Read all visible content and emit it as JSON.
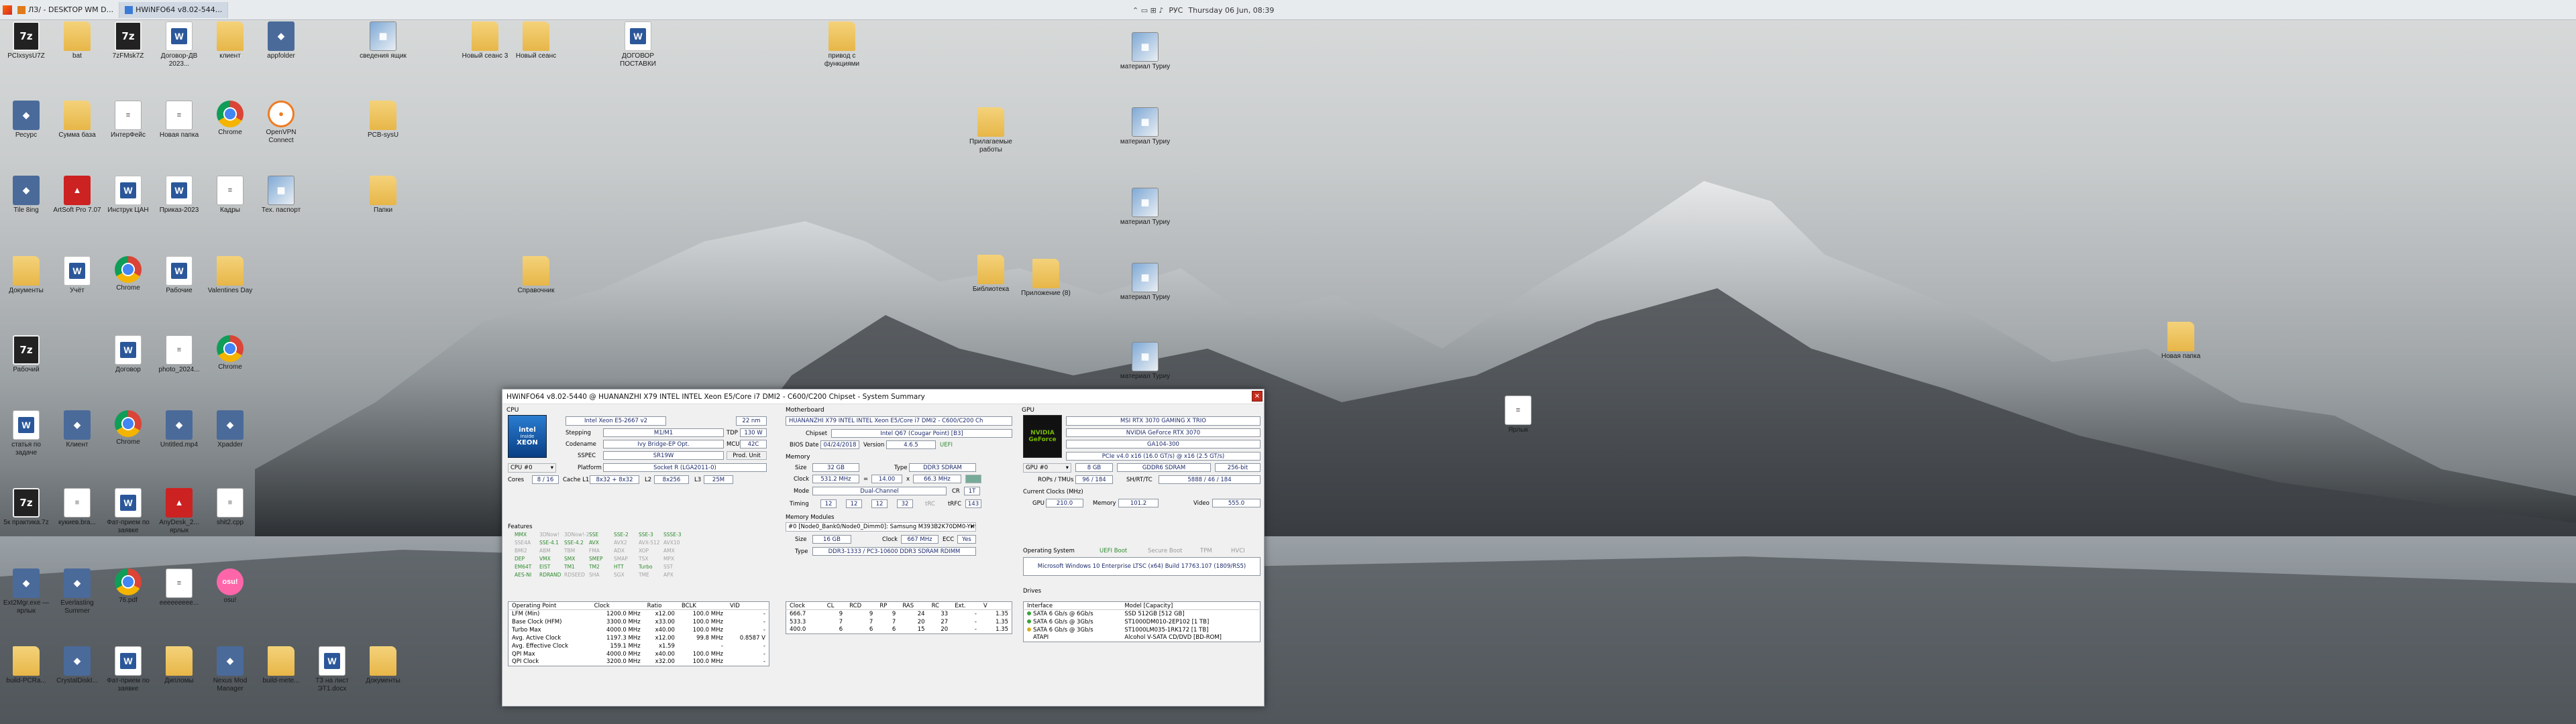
{
  "taskbar": {
    "items": [
      {
        "label": "ЛЗ/ - DESKTOP WM D...",
        "active": false
      },
      {
        "label": "HWiNFO64 v8.02-544...",
        "active": true
      }
    ],
    "tray": {
      "glyphs": "⌃ ▭ ⊞ ♪",
      "lang": "РУС",
      "datetime": "Thursday 06 Jun, 08:39"
    }
  },
  "icons": [
    {
      "id": "a1",
      "label": "PCIxsysU7Z",
      "kind": "7z"
    },
    {
      "id": "a2",
      "label": "bat",
      "kind": "folder"
    },
    {
      "id": "a3",
      "label": "7zFMsk7Z",
      "kind": "7z"
    },
    {
      "id": "a4",
      "label": "Договор-ДВ 2023...",
      "kind": "word"
    },
    {
      "id": "a5",
      "label": "клиент",
      "kind": "folder"
    },
    {
      "id": "a6",
      "label": "appfolder",
      "kind": "app"
    },
    {
      "id": "a7",
      "label": "сведения ящик",
      "kind": "img"
    },
    {
      "id": "a8",
      "label": "Новый сеанс 3",
      "kind": "folder"
    },
    {
      "id": "a9",
      "label": "Новый сеанс",
      "kind": "folder"
    },
    {
      "id": "a10",
      "label": "ДОГОВОР ПОСТАВКИ",
      "kind": "word"
    },
    {
      "id": "a11",
      "label": "привод с функциями",
      "kind": "folder"
    },
    {
      "id": "b1",
      "label": "Ресурс",
      "kind": "app"
    },
    {
      "id": "b2",
      "label": "Сумма база",
      "kind": "folder"
    },
    {
      "id": "b3",
      "label": "ИнтерФейс",
      "kind": "file"
    },
    {
      "id": "b4",
      "label": "Новая папка",
      "kind": "file"
    },
    {
      "id": "b5",
      "label": "Chrome",
      "kind": "chrome"
    },
    {
      "id": "b6",
      "label": "OpenVPN Connect",
      "kind": "ovpn"
    },
    {
      "id": "b7",
      "label": "PCB-sysU",
      "kind": "folder"
    },
    {
      "id": "c1",
      "label": "Tile 8ing",
      "kind": "app"
    },
    {
      "id": "c2",
      "label": "ArtSoft Pro 7.07",
      "kind": "red"
    },
    {
      "id": "c3",
      "label": "Инструк ЦАН",
      "kind": "word"
    },
    {
      "id": "c4",
      "label": "Приказ-2023",
      "kind": "word"
    },
    {
      "id": "c5",
      "label": "Кадры",
      "kind": "file"
    },
    {
      "id": "c6",
      "label": "Тех. паспорт",
      "kind": "img"
    },
    {
      "id": "c7",
      "label": "Папки",
      "kind": "folder"
    },
    {
      "id": "d1",
      "label": "Документы",
      "kind": "folder"
    },
    {
      "id": "d2",
      "label": "Учёт",
      "kind": "word"
    },
    {
      "id": "d3",
      "label": "Chrome",
      "kind": "chrome"
    },
    {
      "id": "d4",
      "label": "Рабочие",
      "kind": "word"
    },
    {
      "id": "d5",
      "label": "Valentines Day",
      "kind": "folder"
    },
    {
      "id": "d6",
      "label": "Справочник",
      "kind": "folder"
    },
    {
      "id": "e1",
      "label": "Рабочий",
      "kind": "7z"
    },
    {
      "id": "e2",
      "label": "Договор",
      "kind": "word"
    },
    {
      "id": "e3",
      "label": "photo_2024...",
      "kind": "file"
    },
    {
      "id": "e4",
      "label": "Chrome",
      "kind": "chrome"
    },
    {
      "id": "f1",
      "label": "статья по задаче",
      "kind": "word"
    },
    {
      "id": "f2",
      "label": "Клиент",
      "kind": "app"
    },
    {
      "id": "f3",
      "label": "Chrome",
      "kind": "chrome"
    },
    {
      "id": "f4",
      "label": "Untitled.mp4",
      "kind": "app"
    },
    {
      "id": "f5",
      "label": "Xpadder",
      "kind": "app"
    },
    {
      "id": "g1",
      "label": "5к практика.7z",
      "kind": "7z"
    },
    {
      "id": "g2",
      "label": "кукиев.bra...",
      "kind": "file"
    },
    {
      "id": "g3",
      "label": "Фат-прием по заявке",
      "kind": "word"
    },
    {
      "id": "g4",
      "label": "AnyDesk_2... ярлык",
      "kind": "red"
    },
    {
      "id": "g5",
      "label": "shit2.cpp",
      "kind": "file"
    },
    {
      "id": "h1",
      "label": "Ext2Mgr.exe — ярлык",
      "kind": "app"
    },
    {
      "id": "h2",
      "label": "Everlasting Summer",
      "kind": "app"
    },
    {
      "id": "h3",
      "label": "76.pdf",
      "kind": "chrome"
    },
    {
      "id": "h4",
      "label": "еееееееее...",
      "kind": "file"
    },
    {
      "id": "h5",
      "label": "osu!",
      "kind": "osu"
    },
    {
      "id": "i1",
      "label": "build-PCRa...",
      "kind": "folder"
    },
    {
      "id": "i2",
      "label": "CrystalDiskI...",
      "kind": "app"
    },
    {
      "id": "i3",
      "label": "Фат-прием по заявке",
      "kind": "word"
    },
    {
      "id": "i4",
      "label": "Дипломы",
      "kind": "folder"
    },
    {
      "id": "i5",
      "label": "Nexus Mod Manager",
      "kind": "app"
    },
    {
      "id": "i6",
      "label": "build-mete...",
      "kind": "folder"
    },
    {
      "id": "i7",
      "label": "ТЗ на лист ЭТ1.docx",
      "kind": "word"
    },
    {
      "id": "i8",
      "label": "Документы",
      "kind": "folder"
    },
    {
      "id": "r1",
      "label": "материал Туриу",
      "kind": "img"
    },
    {
      "id": "r2",
      "label": "материал Туриу",
      "kind": "img"
    },
    {
      "id": "r3",
      "label": "материал Туриу",
      "kind": "img"
    },
    {
      "id": "r4",
      "label": "материал Туриу",
      "kind": "img"
    },
    {
      "id": "r5",
      "label": "материал Туриу",
      "kind": "img"
    },
    {
      "id": "r6",
      "label": "Прилагаемые работы",
      "kind": "folder"
    },
    {
      "id": "r7",
      "label": "Библиотека",
      "kind": "folder"
    },
    {
      "id": "r8",
      "label": "Приложение (8)",
      "kind": "folder"
    },
    {
      "id": "r9",
      "label": "Новая папка",
      "kind": "folder"
    },
    {
      "id": "r10",
      "label": "Ярлык",
      "kind": "file"
    }
  ],
  "hwinfo": {
    "title": "HWiNFO64 v8.02-5440 @ HUANANZHI X79 INTEL INTEL Xeon E5/Core i7 DMI2 - C600/C200 Chipset - System Summary",
    "close": "✕",
    "cpu": {
      "section": "CPU",
      "logo_main": "intel",
      "logo_sub": "XEON",
      "logo_tag": "inside",
      "name": "Intel Xeon E5-2667 v2",
      "nm": "22 nm",
      "stepping_label": "Stepping",
      "stepping": "M1/M1",
      "tdp_label": "TDP",
      "tdp": "130 W",
      "codename_label": "Codename",
      "codename": "Ivy Bridge-EP Opt.",
      "mcu_label": "MCU",
      "mcu": "42C",
      "sspec_label": "SSPEC",
      "sspec": "SR19W",
      "prod": "Prod. Unit",
      "selector": "CPU #0",
      "platform_label": "Platform",
      "platform": "Socket R (LGA2011-0)",
      "cores_label": "Cores",
      "cores": "8 / 16",
      "cache1_label": "Cache L1",
      "cache1": "8x32 + 8x32",
      "l2_label": "L2",
      "l2": "8x256",
      "l3_label": "L3",
      "l3": "25M",
      "features_label": "Features",
      "features": [
        {
          "t": "MMX",
          "on": true
        },
        {
          "t": "3DNow!",
          "on": false
        },
        {
          "t": "3DNow!-2",
          "on": false
        },
        {
          "t": "SSE",
          "on": true
        },
        {
          "t": "SSE-2",
          "on": true
        },
        {
          "t": "SSE-3",
          "on": true
        },
        {
          "t": "SSSE-3",
          "on": true
        },
        {
          "t": "",
          "on": false
        },
        {
          "t": "SSE4A",
          "on": false
        },
        {
          "t": "SSE-4.1",
          "on": true
        },
        {
          "t": "SSE-4.2",
          "on": true
        },
        {
          "t": "AVX",
          "on": true
        },
        {
          "t": "AVX2",
          "on": false
        },
        {
          "t": "AVX-512",
          "on": false
        },
        {
          "t": "AVX10",
          "on": false
        },
        {
          "t": "",
          "on": false
        },
        {
          "t": "BMI2",
          "on": false
        },
        {
          "t": "ABM",
          "on": false
        },
        {
          "t": "TBM",
          "on": false
        },
        {
          "t": "FMA",
          "on": false
        },
        {
          "t": "ADX",
          "on": false
        },
        {
          "t": "XOP",
          "on": false
        },
        {
          "t": "AMX",
          "on": false
        },
        {
          "t": "",
          "on": false
        },
        {
          "t": "DEP",
          "on": true
        },
        {
          "t": "VMX",
          "on": true
        },
        {
          "t": "SMX",
          "on": true
        },
        {
          "t": "SMEP",
          "on": true
        },
        {
          "t": "SMAP",
          "on": false
        },
        {
          "t": "TSX",
          "on": false
        },
        {
          "t": "MPX",
          "on": false
        },
        {
          "t": "",
          "on": false
        },
        {
          "t": "EM64T",
          "on": true
        },
        {
          "t": "EIST",
          "on": true
        },
        {
          "t": "TM1",
          "on": true
        },
        {
          "t": "TM2",
          "on": true
        },
        {
          "t": "HTT",
          "on": true
        },
        {
          "t": "Turbo",
          "on": true
        },
        {
          "t": "SST",
          "on": false
        },
        {
          "t": "",
          "on": false
        },
        {
          "t": "AES-NI",
          "on": true
        },
        {
          "t": "RDRAND",
          "on": true
        },
        {
          "t": "RDSEED",
          "on": false
        },
        {
          "t": "SHA",
          "on": false
        },
        {
          "t": "SGX",
          "on": false
        },
        {
          "t": "TME",
          "on": false
        },
        {
          "t": "APX",
          "on": false
        },
        {
          "t": "",
          "on": false
        }
      ],
      "op_headers": [
        "Operating Point",
        "Clock",
        "Ratio",
        "BCLK",
        "VID"
      ],
      "op_rows": [
        [
          "LFM (Min)",
          "1200.0 MHz",
          "x12.00",
          "100.0 MHz",
          "-"
        ],
        [
          "Base Clock (HFM)",
          "3300.0 MHz",
          "x33.00",
          "100.0 MHz",
          "-"
        ],
        [
          "Turbo Max",
          "4000.0 MHz",
          "x40.00",
          "100.0 MHz",
          "-"
        ],
        [
          "Avg. Active Clock",
          "1197.3 MHz",
          "x12.00",
          "99.8 MHz",
          "0.8587 V"
        ],
        [
          "Avg. Effective Clock",
          "159.1 MHz",
          "x1.59",
          "-",
          "-"
        ],
        [
          "QPI Max",
          "4000.0 MHz",
          "x40.00",
          "100.0 MHz",
          "-"
        ],
        [
          "QPI Clock",
          "3200.0 MHz",
          "x32.00",
          "100.0 MHz",
          "-"
        ]
      ]
    },
    "mb": {
      "section": "Motherboard",
      "name": "HUANANZHI X79 INTEL INTEL Xeon E5/Core i7 DMI2 - C600/C200 Ch",
      "chipset_label": "Chipset",
      "chipset": "Intel Q67 (Cougar Point) [B3]",
      "bios_label": "BIOS Date",
      "bios_date": "04/24/2018",
      "version_label": "Version",
      "version": "4.6.5",
      "uefi": "UEFI",
      "mem_section": "Memory",
      "size_label": "Size",
      "size": "32 GB",
      "type_label": "Type",
      "type": "DDR3 SDRAM",
      "clock_label": "Clock",
      "clock": "531.2 MHz",
      "eq": "=",
      "mult": "14.00",
      "x": "x",
      "bclk": "66.3 MHz",
      "mode_label": "Mode",
      "mode": "Dual-Channel",
      "cr_label": "CR",
      "cr": "1T",
      "timing_label": "Timing",
      "timings": [
        "12",
        "12",
        "12",
        "32"
      ],
      "trc_label": "tRC",
      "trfc_label": "tRFC",
      "trfc": "143",
      "modules_label": "Memory Modules",
      "module": "#0 [Node0_Bank0/Node0_Dimm0]: Samsung M393B2K70DM0-YH9",
      "mod_size_label": "Size",
      "mod_size": "16 GB",
      "mod_clock_label": "Clock",
      "mod_clock": "667 MHz",
      "ecc_label": "ECC",
      "ecc": "Yes",
      "mod_type_label": "Type",
      "mod_type": "DDR3-1333 / PC3-10600 DDR3 SDRAM RDIMM",
      "timing_headers": [
        "Clock",
        "CL",
        "RCD",
        "RP",
        "RAS",
        "RC",
        "Ext.",
        "V"
      ],
      "timing_rows": [
        [
          "666.7",
          "9",
          "9",
          "9",
          "24",
          "33",
          "-",
          "1.35"
        ],
        [
          "533.3",
          "7",
          "7",
          "7",
          "20",
          "27",
          "-",
          "1.35"
        ],
        [
          "400.0",
          "6",
          "6",
          "6",
          "15",
          "20",
          "-",
          "1.35"
        ]
      ]
    },
    "gpu": {
      "section": "GPU",
      "logo_main": "NVIDIA",
      "logo_sub": "GeForce",
      "name1": "MSI RTX 3070 GAMING X TRIO",
      "name2": "NVIDIA GeForce RTX 3070",
      "chip": "GA104-300",
      "bus": "PCIe v4.0 x16 (16.0 GT/s) @ x16 (2.5 GT/s)",
      "selector": "GPU #0",
      "vram": "8 GB",
      "vram_type": "GDDR6 SDRAM",
      "vram_bus": "256-bit",
      "rops_label": "ROPs / TMUs",
      "rops": "96 / 184",
      "sh_label": "SH/RT/TC",
      "sh": "5888 / 46 / 184",
      "clocks_label": "Current Clocks (MHz)",
      "gpu_clk_label": "GPU",
      "gpu_clk": "210.0",
      "mem_clk_label": "Memory",
      "mem_clk": "101.2",
      "video_clk_label": "Video",
      "video_clk": "555.0",
      "os_label": "Operating System",
      "uefi": "UEFI Boot",
      "secure": "Secure Boot",
      "tpm": "TPM",
      "hvci": "HVCI",
      "os": "Microsoft Windows 10 Enterprise LTSC (x64) Build 17763.107 (1809/RS5)",
      "drives_label": "Drives",
      "drive_headers": [
        "Interface",
        "Model [Capacity]"
      ],
      "drives": [
        {
          "iface": "SATA 6 Gb/s @ 6Gb/s",
          "model": "SSD 512GB [512 GB]",
          "st": "g"
        },
        {
          "iface": "SATA 6 Gb/s @ 3Gb/s",
          "model": "ST1000DM010-2EP102 [1 TB]",
          "st": "g"
        },
        {
          "iface": "SATA 6 Gb/s @ 3Gb/s",
          "model": "ST1000LM035-1RK172 [1 TB]",
          "st": "y"
        },
        {
          "iface": "ATAPI",
          "model": "Alcohol V-SATA CD/DVD [BD-ROM]",
          "st": "n"
        }
      ]
    }
  }
}
